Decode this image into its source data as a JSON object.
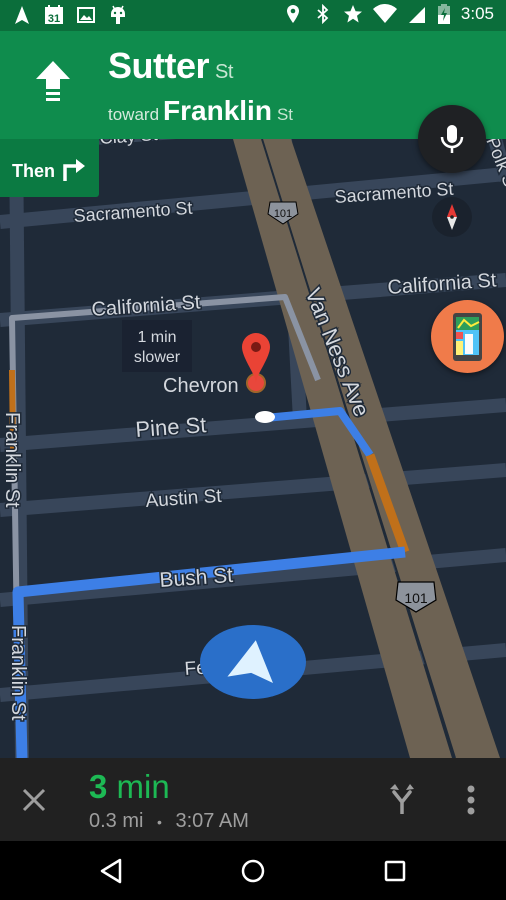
{
  "status_bar": {
    "left_icons": [
      "navigation-icon",
      "calendar-icon",
      "image-icon",
      "android-icon"
    ],
    "calendar_day": "31",
    "right_icons": [
      "location-icon",
      "bluetooth-icon",
      "star-icon",
      "wifi-icon",
      "signal-icon",
      "battery-charging-icon"
    ],
    "time": "3:05"
  },
  "navigation_header": {
    "maneuver_icon": "straight-arrow-icon",
    "street_name": "Sutter",
    "street_suffix": "St",
    "toward_label": "toward",
    "toward_name": "Franklin",
    "toward_suffix": "St",
    "color": "#0f8c4d"
  },
  "then_chip": {
    "label": "Then",
    "icon": "turn-right-icon"
  },
  "map": {
    "street_labels": [
      "Clay St",
      "Sacramento St",
      "Sacramento St",
      "California St",
      "California St",
      "Pine St",
      "Austin St",
      "Bush St",
      "Fern St",
      "Franklin St",
      "Franklin St",
      "Van Ness Ave",
      "Polk St"
    ],
    "highway_shield": "101",
    "poi_label": "Chevron",
    "route_callout": {
      "line1": "1 min",
      "line2": "slower"
    },
    "route_color": "#3d7fe6",
    "traffic_color": "#c0701a"
  },
  "floating_buttons": {
    "mic": "microphone-icon",
    "compass": "compass-icon",
    "layers": "traffic-map-icon"
  },
  "bottom_panel": {
    "close_icon": "close-icon",
    "eta_value": "3",
    "eta_unit": "min",
    "distance": "0.3 mi",
    "separator": "•",
    "arrival_time": "3:07 AM",
    "alternates_icon": "alternate-routes-icon",
    "more_icon": "more-vertical-icon",
    "eta_color": "#1db954"
  },
  "system_nav": {
    "back": "back-icon",
    "home": "home-icon",
    "recents": "recents-icon"
  }
}
